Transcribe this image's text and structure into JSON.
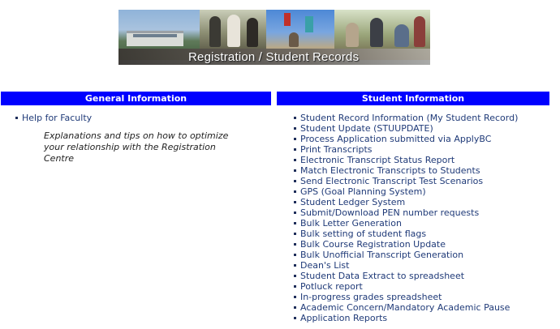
{
  "banner": {
    "caption": "Registration / Student Records"
  },
  "general": {
    "header": "General Information",
    "links": [
      "Help for Faculty"
    ],
    "description": "Explanations and tips on how to optimize your relationship with the Registration Centre"
  },
  "student": {
    "header": "Student Information",
    "links": [
      "Student Record Information (My Student Record)",
      "Student Update (STUUPDATE)",
      "Process Application submitted via ApplyBC",
      "Print Transcripts",
      "Electronic Transcript Status Report",
      "Match Electronic Transcripts to Students",
      "Send Electronic Transcript Test Scenarios",
      "GPS (Goal Planning System)",
      "Student Ledger System",
      "Submit/Download PEN number requests",
      "Bulk Letter Generation",
      "Bulk setting of student flags",
      "Bulk Course Registration Update",
      "Bulk Unofficial Transcript Generation",
      "Dean's List",
      "Student Data Extract to spreadsheet",
      "Potluck report",
      "In-progress grades spreadsheet",
      "Academic Concern/Mandatory Academic Pause",
      "Application Reports"
    ]
  },
  "colors": {
    "header_bg": "#0000ff",
    "link": "#1f3a78"
  }
}
